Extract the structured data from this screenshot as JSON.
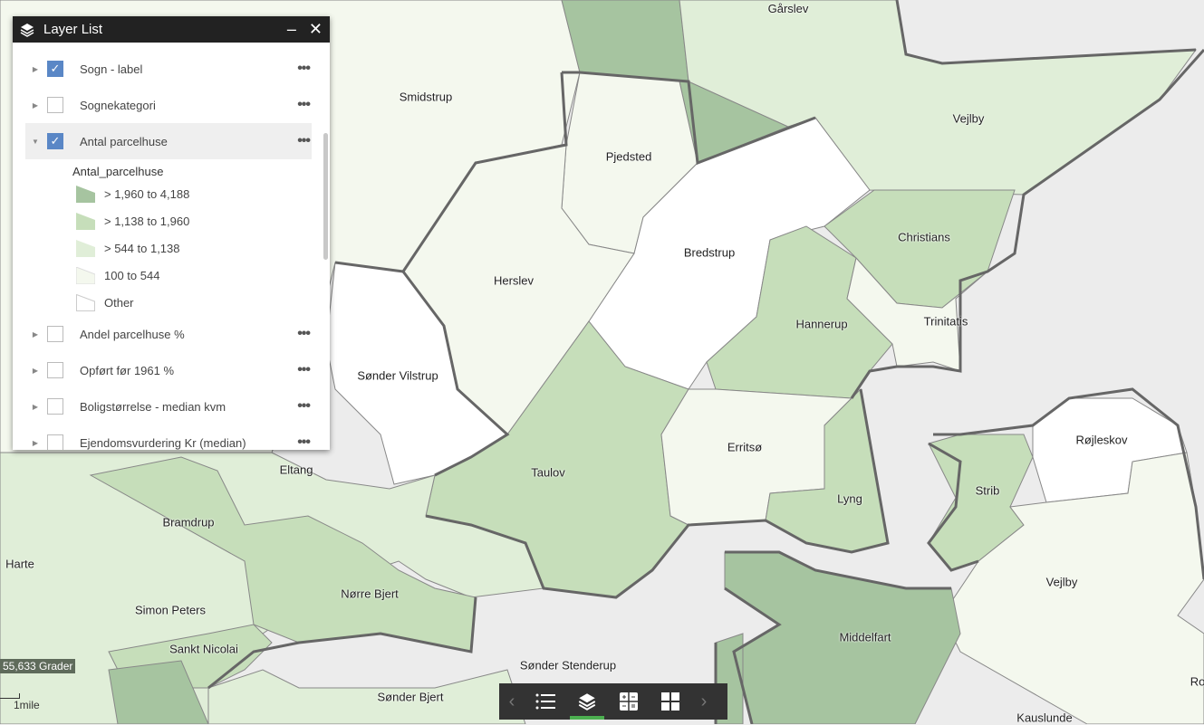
{
  "colors": {
    "c1": "#a6c4a0",
    "c2": "#c6deba",
    "c3": "#e0eed8",
    "c4": "#f4f8ee",
    "c5": "#ffffff",
    "water": "#ececec"
  },
  "map": {
    "labels": [
      "Gårslev",
      "Smidstrup",
      "Vejlby",
      "Pjedsted",
      "Bredstrup",
      "Christians",
      "Herslev",
      "Hannerup",
      "Trinitatis",
      "Sønder Vilstrup",
      "Erritsø",
      "Taulov",
      "Lyng",
      "Strib",
      "Røjleskov",
      "Eltang",
      "Bramdrup",
      "Harte",
      "Nørre Bjert",
      "Simon Peters",
      "Sankt Nicolai",
      "Vejlby",
      "Middelfart",
      "Sønder Stenderup",
      "Sønder Bjert",
      "Kauslunde",
      "Ro"
    ],
    "coordinate": "55,633 Grader",
    "scale": "1mile"
  },
  "panel": {
    "title": "Layer List",
    "minimize": "–",
    "close": "✕",
    "layers": [
      {
        "name": "Sogn - label",
        "checked": true
      },
      {
        "name": "Sognekategori",
        "checked": false
      },
      {
        "name": "Antal parcelhuse",
        "checked": true
      },
      {
        "name": "Andel parcelhuse %",
        "checked": false
      },
      {
        "name": "Opført før 1961 %",
        "checked": false
      },
      {
        "name": "Boligstørrelse - median kvm",
        "checked": false
      },
      {
        "name": "Ejendomsvurdering Kr (median)",
        "checked": false
      }
    ],
    "legend_title": "Antal_parcelhuse",
    "legend": [
      "> 1,960 to 4,188",
      "> 1,138 to 1,960",
      "> 544 to 1,138",
      "100 to 544",
      "Other"
    ],
    "more": "•••"
  },
  "toolbar": {
    "prev": "‹",
    "next": "›"
  }
}
